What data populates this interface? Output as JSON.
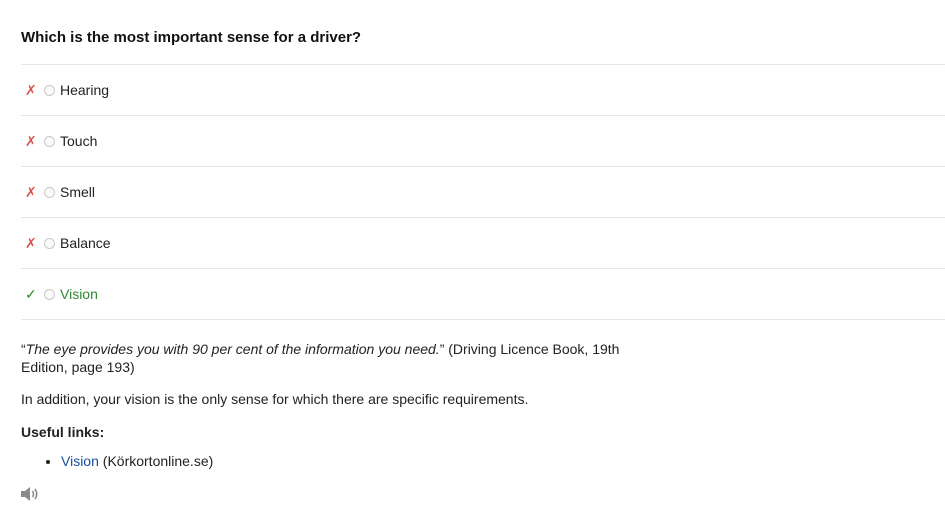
{
  "question": "Which is the most important sense for a driver?",
  "options": [
    {
      "label": "Hearing",
      "mark": "✗",
      "correct": false
    },
    {
      "label": "Touch",
      "mark": "✗",
      "correct": false
    },
    {
      "label": "Smell",
      "mark": "✗",
      "correct": false
    },
    {
      "label": "Balance",
      "mark": "✗",
      "correct": false
    },
    {
      "label": "Vision",
      "mark": "✓",
      "correct": true
    }
  ],
  "explanation": {
    "quote_open": "“",
    "quote": "The eye provides you with 90 per cent of the information you need.",
    "quote_close": "”",
    "source": " (Driving Licence Book, 19th Edition, page 193)",
    "addition": "In addition, your vision is the only sense for which there are specific requirements."
  },
  "links": {
    "heading": "Useful links:",
    "items": [
      {
        "link_text": "Vision",
        "suffix": " (Körkortonline.se)"
      }
    ]
  },
  "icons": {
    "speaker": "speaker-icon"
  },
  "colors": {
    "wrong": "#d9534f",
    "correct": "#2e8b2e",
    "link": "#1a4f9c"
  }
}
